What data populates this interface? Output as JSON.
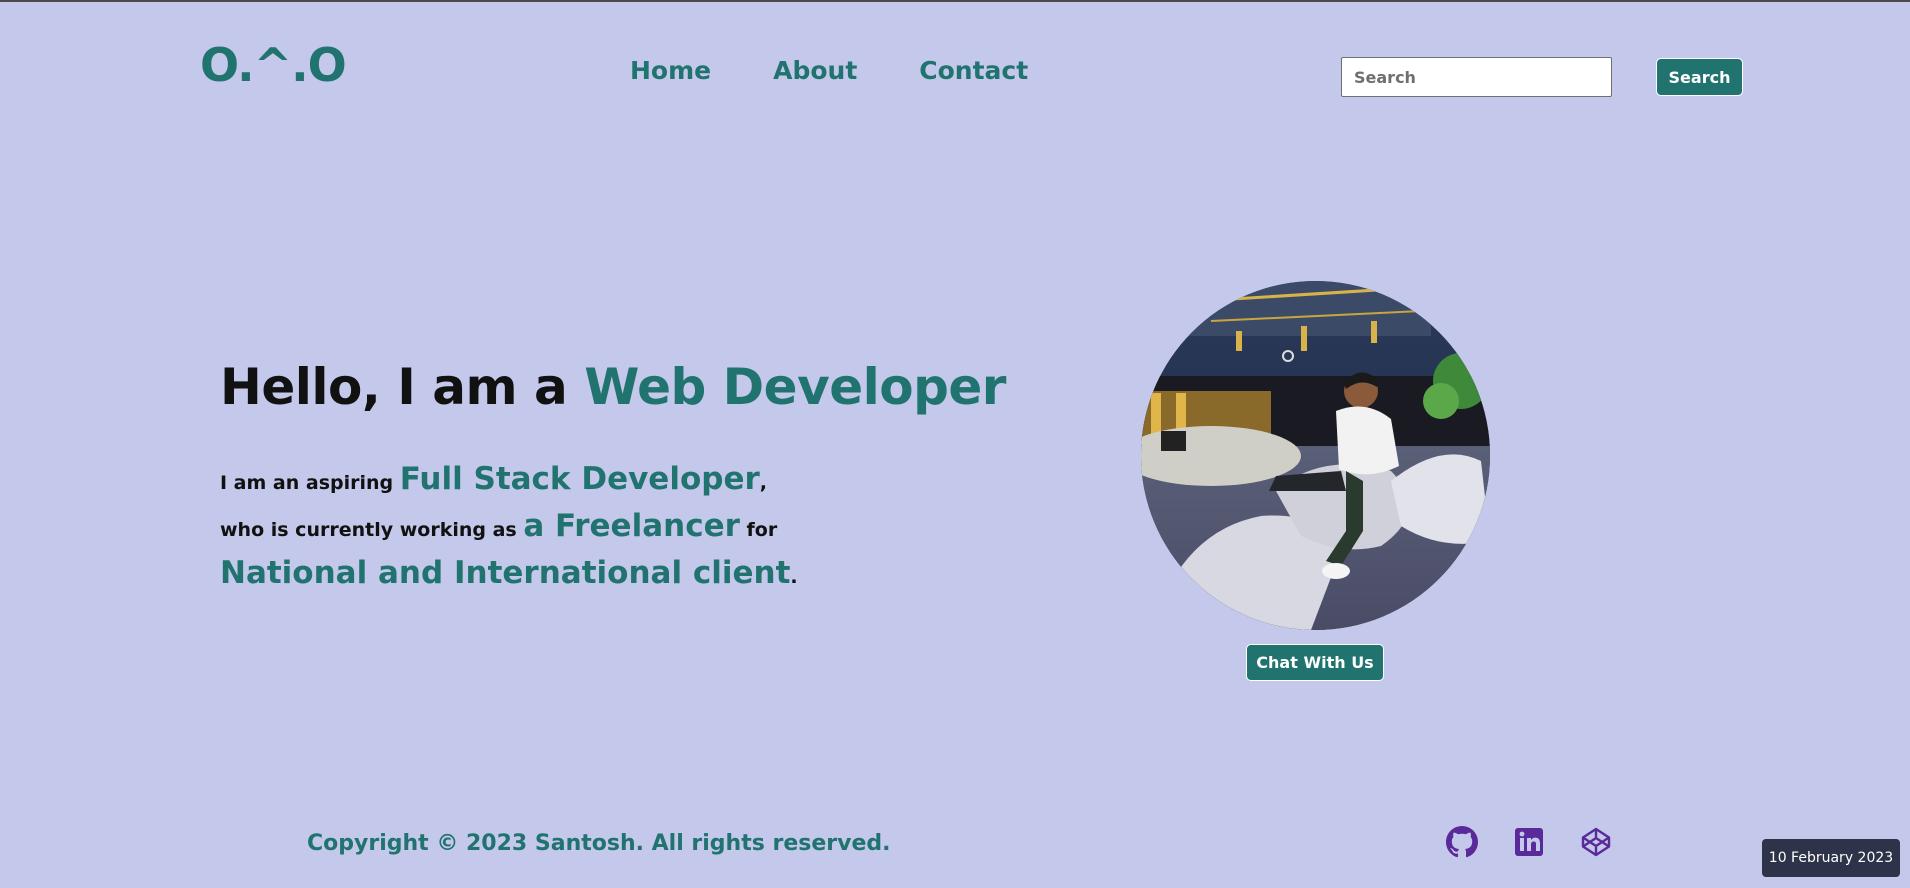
{
  "header": {
    "logo": "O.^.O",
    "nav": [
      "Home",
      "About",
      "Contact"
    ],
    "search_placeholder": "Search",
    "search_button": "Search"
  },
  "hero": {
    "title_prefix": "Hello, I am a ",
    "title_accent": "Web Developer",
    "line1_prefix": "I am an aspiring ",
    "line1_accent": "Full Stack Developer",
    "line1_suffix": ",",
    "line2_prefix": "who is currently working as ",
    "line2_accent": "a Freelancer",
    "line2_suffix": " for",
    "line3_accent": "National and International client",
    "line3_suffix": ".",
    "chat_button": "Chat With Us"
  },
  "footer": {
    "copyright": "Copyright © 2023 Santosh. All rights reserved.",
    "social_icons": [
      "github-icon",
      "linkedin-icon",
      "codepen-icon"
    ]
  },
  "taskbar": {
    "date": "10 February 2023"
  },
  "colors": {
    "background": "#c4c8ea",
    "accent": "#20736f",
    "social": "#5a2a9a"
  }
}
